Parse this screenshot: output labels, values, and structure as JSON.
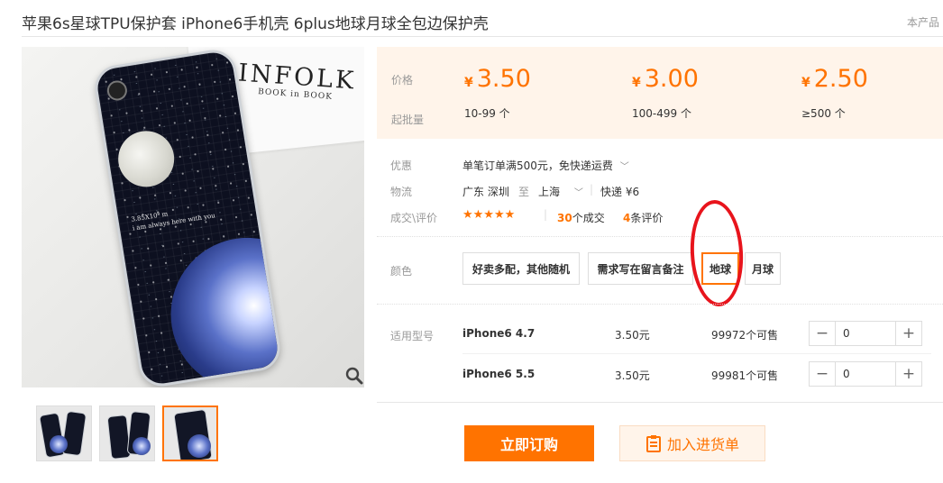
{
  "product": {
    "title": "苹果6s星球TPU保护套 iPhone6手机壳 6plus地球月球全包边保护壳",
    "side_note": "本产品"
  },
  "image": {
    "brand_text": "INFOLK",
    "book_text": "BOOK in BOOK",
    "case_text_line1": "3.85X10⁸ m",
    "case_text_line2": "i am always here with you"
  },
  "price_panel": {
    "price_label": "价格",
    "batch_label": "起批量",
    "currency": "¥",
    "tiers": [
      {
        "price": "3.50",
        "range": "10-99 个"
      },
      {
        "price": "3.00",
        "range": "100-499 个"
      },
      {
        "price": "2.50",
        "range": "≥500 个"
      }
    ]
  },
  "info": {
    "promo_label": "优惠",
    "promo_value": "单笔订单满500元，免快递运费",
    "logistics_label": "物流",
    "from": "广东 深圳",
    "to_word": "至",
    "to": "上海",
    "shipping": "快递 ¥6",
    "rating_label": "成交\\评价",
    "stars": "★★★★★",
    "deals_count": "30",
    "deals_text": "个成交",
    "reviews_count": "4",
    "reviews_text": "条评价"
  },
  "color": {
    "label": "颜色",
    "options": [
      "好卖多配，其他随机",
      "需求写在留言备注",
      "地球",
      "月球"
    ],
    "selected": "地球"
  },
  "models": {
    "label": "适用型号",
    "rows": [
      {
        "name": "iPhone6 4.7",
        "price": "3.50元",
        "stock": "99972个可售",
        "qty": "0"
      },
      {
        "name": "iPhone6 5.5",
        "price": "3.50元",
        "stock": "99981个可售",
        "qty": "0"
      }
    ]
  },
  "actions": {
    "buy": "立即订购",
    "add_to_list": "加入进货单"
  },
  "colors": {
    "accent": "#ff7300",
    "panel_bg": "#fff4ea",
    "annotation": "#e8141c"
  }
}
